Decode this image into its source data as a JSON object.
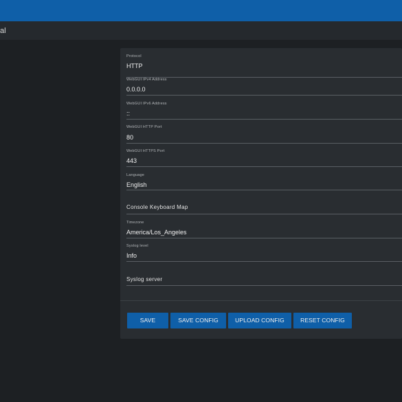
{
  "breadcrumb": "al",
  "form": {
    "protocol": {
      "label": "Protocol",
      "value": "HTTP"
    },
    "ipv4": {
      "label": "WebGUI IPv4 Address",
      "value": "0.0.0.0"
    },
    "ipv6": {
      "label": "WebGUI IPv6 Address",
      "value": "::"
    },
    "http_port": {
      "label": "WebGUI HTTP Port",
      "value": "80"
    },
    "https_port": {
      "label": "WebGUI HTTPS Port",
      "value": "443"
    },
    "language": {
      "label": "Language",
      "value": "English"
    },
    "console_keymap": {
      "placeholder": "Console Keyboard Map"
    },
    "timezone": {
      "label": "Timezone",
      "value": "America/Los_Angeles"
    },
    "syslog_level": {
      "label": "Syslog level",
      "value": "Info"
    },
    "syslog_server": {
      "placeholder": "Syslog server"
    }
  },
  "buttons": {
    "save": "SAVE",
    "save_config": "SAVE CONFIG",
    "upload_config": "UPLOAD CONFIG",
    "reset_config": "RESET CONFIG"
  }
}
